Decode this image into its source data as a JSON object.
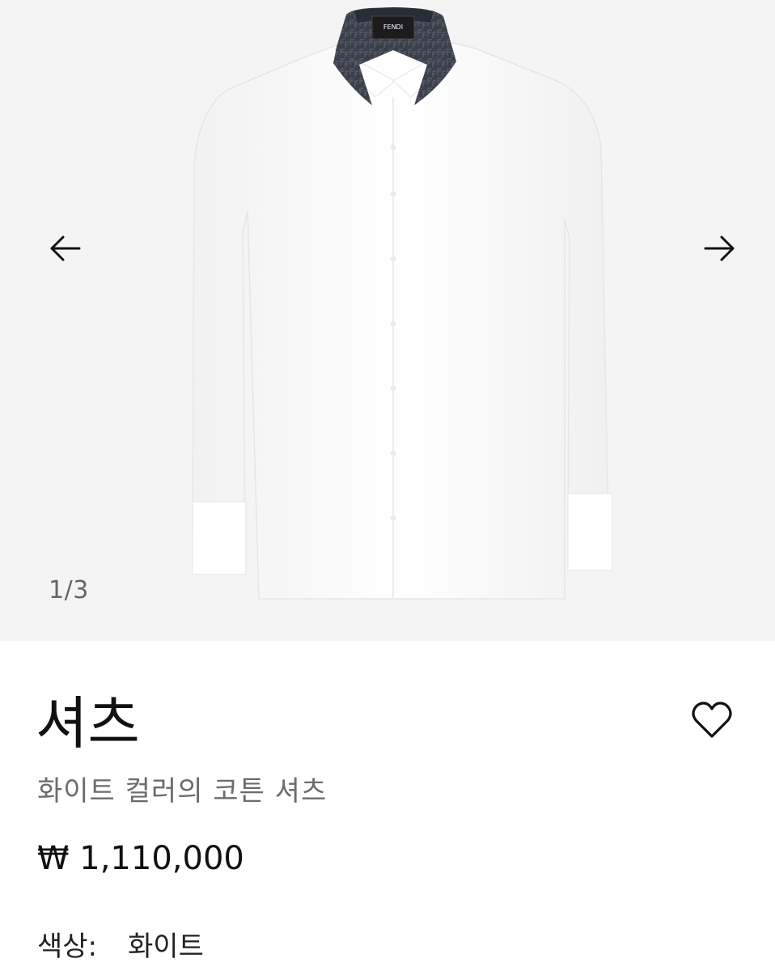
{
  "gallery": {
    "counter": "1/3",
    "prev_icon": "arrow-left-icon",
    "next_icon": "arrow-right-icon",
    "image_subject": "white-shirt-with-dark-collar",
    "collar_label": "FENDI",
    "background_color": "#f4f4f4"
  },
  "product": {
    "title": "셔츠",
    "subtitle": "화이트 컬러의 코튼 셔츠",
    "price": "₩ 1,110,000",
    "color_label": "색상:",
    "color_value": "화이트",
    "wishlist_icon": "heart-icon"
  }
}
